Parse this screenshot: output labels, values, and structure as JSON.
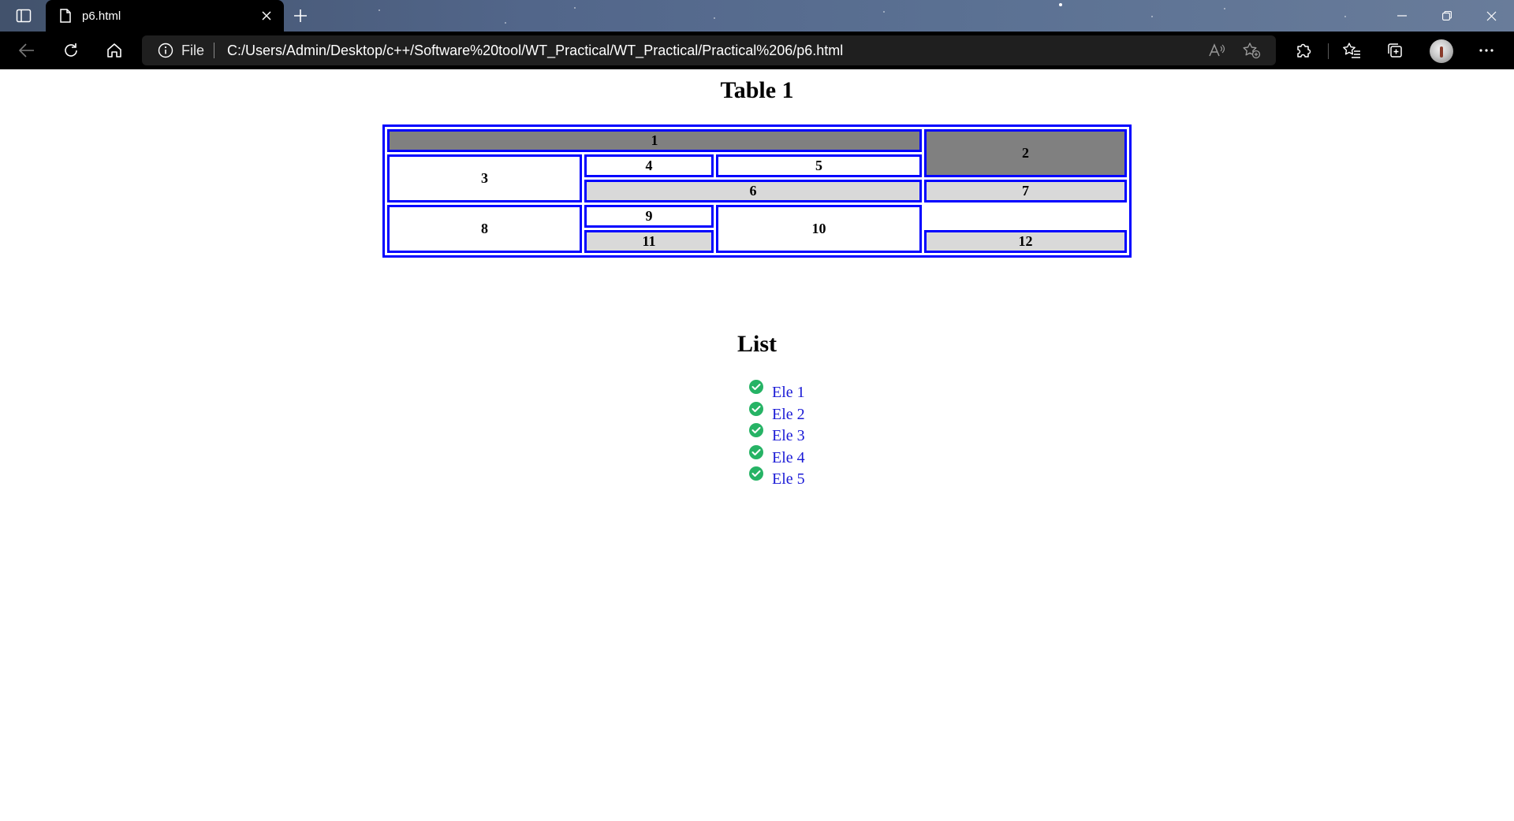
{
  "browser": {
    "tab_title": "p6.html",
    "address_scheme": "File",
    "address_url": "C:/Users/Admin/Desktop/c++/Software%20tool/WT_Practical/WT_Practical/Practical%206/p6.html"
  },
  "page": {
    "table_heading": "Table 1",
    "table_cells": {
      "c1": "1",
      "c2": "2",
      "c3": "3",
      "c4": "4",
      "c5": "5",
      "c6": "6",
      "c7": "7",
      "c8": "8",
      "c9": "9",
      "c10": "10",
      "c11": "11",
      "c12": "12"
    },
    "table_colors": {
      "border": "#0000ff",
      "dark": "#808080",
      "light": "#d9d9d9"
    },
    "list_heading": "List",
    "list_items": [
      "Ele 1",
      "Ele 2",
      "Ele 3",
      "Ele 4",
      "Ele 5"
    ],
    "list_icon": "check-circle-icon",
    "link_color": "#1a1ad6"
  }
}
